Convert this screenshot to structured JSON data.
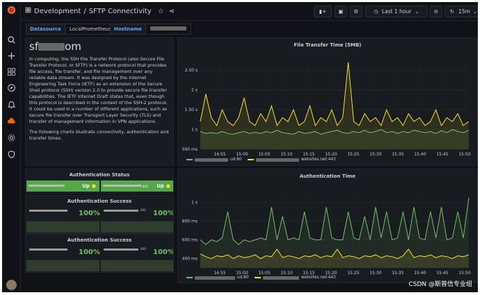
{
  "topbar": {
    "breadcrumb_folder": "Development",
    "separator": "/",
    "breadcrumb_dashboard": "SFTP Connectivity",
    "time_range": "Last 1 hour",
    "refresh": "15m"
  },
  "variables": [
    {
      "label": "Datasource",
      "value": "LocalPrometheus"
    },
    {
      "label": "Hostname",
      "value": ""
    }
  ],
  "text_panel": {
    "title_prefix": "sf",
    "title_suffix": "om",
    "paragraph1": "In computing, the SSH File Transfer Protocol (also Secure File Transfer Protocol, or SFTP) is a network protocol that provides file access, file transfer, and file management over any reliable data stream. It was designed by the Internet Engineering Task Force (IETF) as an extension of the Secure Shell protocol (SSH) version 2.0 to provide secure file transfer capabilities. The IETF Internet Draft states that, even though this protocol is described in the context of the SSH-2 protocol, it could be used in a number of different applications, such as secure file transfer over Transport Layer Security (TLS) and transfer of management information in VPN applications.",
    "paragraph2": "The following charts illustrate connectivity, authentication and transfer times."
  },
  "auth_status": {
    "title": "Authentication Status",
    "items": [
      {
        "value": "Up",
        "label_suffix": ""
      },
      {
        "value": "Up",
        "label_suffix": "443"
      }
    ]
  },
  "auth_success_1": {
    "title": "Authentication Success",
    "items": [
      {
        "value": "100%",
        "label_suffix": ""
      },
      {
        "value": "100%",
        "label_suffix": "443"
      }
    ]
  },
  "auth_success_2": {
    "title": "Authentication Success",
    "items": [
      {
        "value": "100%",
        "label_suffix": ""
      },
      {
        "value": "100%",
        "label_suffix": "443"
      }
    ]
  },
  "watermark": "CSDN @斯普信专业组",
  "colors": {
    "green": "#73bf69",
    "yellow": "#fade2a",
    "status_up": "#56a64b"
  },
  "chart_data": [
    {
      "type": "line",
      "title": "File Transfer Time (5MB)",
      "x": [
        "14:55",
        "15:00",
        "15:05",
        "15:10",
        "15:15",
        "15:20",
        "15:25",
        "15:30",
        "15:35",
        "15:40",
        "15:45",
        "15:50"
      ],
      "yticks": [
        "500 ms",
        "1 s",
        "1.50 s",
        "2 s",
        "2.50 s"
      ],
      "ylim": [
        0.5,
        2.75
      ],
      "series": [
        {
          "name": "ud:80",
          "legend_suffix": "ud:80",
          "color": "#73bf69",
          "values": [
            0.95,
            0.9,
            0.92,
            0.9,
            0.95,
            0.9,
            0.88,
            0.92,
            0.95,
            0.9,
            0.93,
            0.9,
            0.95,
            0.92,
            0.98,
            0.92,
            0.9,
            0.88,
            0.95,
            0.9,
            0.92,
            0.95,
            0.88,
            0.92,
            0.95,
            0.98,
            0.92,
            0.9,
            0.95,
            0.92,
            0.98,
            0.92,
            0.95,
            1.0,
            0.92,
            0.95,
            0.9,
            0.95,
            0.92,
            0.98,
            0.95,
            0.92,
            0.95,
            0.9,
            0.97,
            0.92,
            1.0,
            0.95,
            0.92,
            0.98
          ]
        },
        {
          "name": "websites.net:443",
          "legend_suffix": "websites.net:443",
          "color": "#fade2a",
          "values": [
            1.2,
            1.9,
            1.3,
            1.1,
            1.5,
            1.2,
            1.1,
            1.3,
            1.8,
            1.2,
            1.1,
            1.4,
            1.2,
            1.6,
            1.1,
            1.3,
            1.2,
            1.5,
            1.1,
            1.2,
            1.6,
            1.1,
            1.3,
            1.2,
            1.5,
            1.1,
            1.3,
            2.7,
            1.2,
            1.1,
            1.4,
            1.2,
            1.3,
            1.1,
            1.5,
            1.2,
            1.3,
            1.1,
            1.4,
            1.2,
            1.3,
            1.1,
            1.2,
            1.5,
            1.1,
            1.3,
            1.2,
            1.4,
            1.1,
            1.2
          ]
        }
      ]
    },
    {
      "type": "line",
      "title": "Authentication Time",
      "x": [
        "14:55",
        "15:00",
        "15:05",
        "15:10",
        "15:15",
        "15:20",
        "15:25",
        "15:30",
        "15:35",
        "15:40",
        "15:45",
        "15:50"
      ],
      "yticks": [
        "400 ms",
        "600 ms",
        "800 ms",
        "1 s"
      ],
      "ylim": [
        0.3,
        1.1
      ],
      "series": [
        {
          "name": "ud:80",
          "legend_suffix": "ud:80",
          "color": "#73bf69",
          "values": [
            0.6,
            0.55,
            0.6,
            0.58,
            0.62,
            0.9,
            0.6,
            0.55,
            0.6,
            0.58,
            0.6,
            0.62,
            0.6,
            0.95,
            0.6,
            0.85,
            0.6,
            0.62,
            0.6,
            0.9,
            0.62,
            0.6,
            0.6,
            0.95,
            0.62,
            0.6,
            0.6,
            0.9,
            0.62,
            0.6,
            0.85,
            0.6,
            0.95,
            0.62,
            0.9,
            0.6,
            0.62,
            0.9,
            0.6,
            0.95,
            0.62,
            0.6,
            0.9,
            0.62,
            0.95,
            0.6,
            0.62,
            0.9,
            0.62,
            1.05
          ]
        },
        {
          "name": "websites.net:443",
          "legend_suffix": "websites.net:443",
          "color": "#fade2a",
          "values": [
            0.45,
            0.42,
            0.4,
            0.43,
            0.42,
            0.44,
            0.4,
            0.43,
            0.41,
            0.42,
            0.44,
            0.4,
            0.43,
            0.42,
            0.5,
            0.41,
            0.43,
            0.42,
            0.4,
            0.43,
            0.42,
            0.44,
            0.41,
            0.43,
            0.42,
            0.5,
            0.41,
            0.43,
            0.42,
            0.4,
            0.43,
            0.42,
            0.44,
            0.41,
            0.43,
            0.42,
            0.4,
            0.43,
            0.5,
            0.41,
            0.43,
            0.42,
            0.44,
            0.41,
            0.43,
            0.42,
            0.4,
            0.43,
            0.42,
            0.44
          ]
        }
      ]
    }
  ]
}
